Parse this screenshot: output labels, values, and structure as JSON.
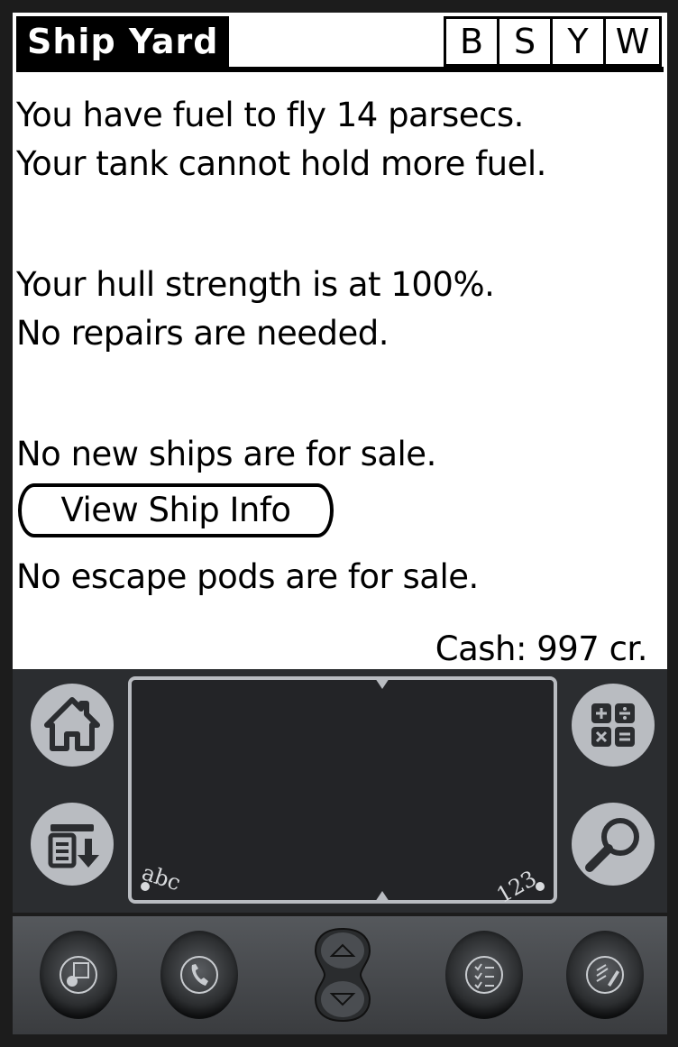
{
  "screen": {
    "title": "Ship Yard",
    "shortcuts": [
      "B",
      "S",
      "Y",
      "W"
    ],
    "fuel_line": "You have fuel to fly 14 parsecs.",
    "tank_line": "Your tank cannot hold more fuel.",
    "hull_line": "Your hull strength is at 100%.",
    "repair_line": "No repairs are needed.",
    "ships_line": "No new ships are for sale.",
    "view_ship_info_label": "View  Ship Info",
    "pods_line": "No escape pods are for sale.",
    "cash": "Cash: 997 cr."
  },
  "silkscreen": {
    "left_buttons": [
      "home-icon",
      "menu-icon"
    ],
    "right_buttons": [
      "calculator-icon",
      "find-icon"
    ],
    "abc_label": "abc",
    "num_label": "123"
  },
  "hardware_buttons": [
    "date-book-icon",
    "phone-icon",
    "scroll-rocker",
    "todo-icon",
    "memo-icon"
  ],
  "colors": {
    "screen_bg": "#ffffff",
    "text": "#000000",
    "frame": "#1c1c1c",
    "silkscreen_bg": "#2b2d30",
    "silkscreen_fg": "#b9bcc1"
  }
}
